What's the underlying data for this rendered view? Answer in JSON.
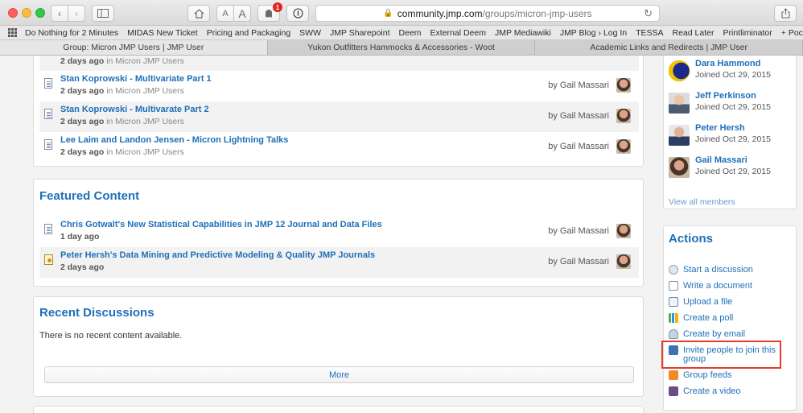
{
  "browser": {
    "address_domain": "community.jmp.com",
    "address_path": "/groups/micron-jmp-users",
    "notification_count": "1",
    "bookmarks": [
      "Do Nothing for 2 Minutes",
      "MIDAS New Ticket",
      "Pricing and Packaging",
      "SWW",
      "JMP Sharepoint",
      "Deem",
      "External Deem",
      "JMP Mediawiki",
      "JMP Blog › Log In",
      "TESSA",
      "Read Later",
      "Printliminator",
      "+ Pocket"
    ],
    "tabs": [
      "Group: Micron JMP Users | JMP User",
      "Yukon Outfitters Hammocks & Accessories - Woot",
      "Academic Links and Redirects | JMP User"
    ]
  },
  "content_list": {
    "rows": [
      {
        "title": "",
        "time": "2 days ago",
        "in_text": " in Micron JMP Users",
        "by": ""
      },
      {
        "title": "Stan Koprowski - Multivariate Part 1",
        "time": "2 days ago",
        "in_text": " in Micron JMP Users",
        "by": "by Gail Massari"
      },
      {
        "title": "Stan Koprowski - Multivarate Part 2",
        "time": "2 days ago",
        "in_text": " in Micron JMP Users",
        "by": "by Gail Massari"
      },
      {
        "title": "Lee Laim and Landon Jensen - Micron Lightning Talks",
        "time": "2 days ago",
        "in_text": " in Micron JMP Users",
        "by": "by Gail Massari"
      }
    ]
  },
  "featured": {
    "title": "Featured Content",
    "rows": [
      {
        "title": "Chris Gotwalt's New Statistical Capabilities in JMP 12 Journal and Data Files",
        "time": "1 day ago",
        "by": "by Gail Massari"
      },
      {
        "title": "Peter Hersh's Data Mining and Predictive Modeling & Quality JMP Journals",
        "time": "2 days ago",
        "by": "by Gail Massari"
      }
    ]
  },
  "discussions": {
    "title": "Recent Discussions",
    "empty_text": "There is no recent content available.",
    "more_label": "More"
  },
  "members": {
    "list": [
      {
        "name": "Dara Hammond",
        "joined": "Joined Oct 29, 2015"
      },
      {
        "name": "Jeff Perkinson",
        "joined": "Joined Oct 29, 2015"
      },
      {
        "name": "Peter Hersh",
        "joined": "Joined Oct 29, 2015"
      },
      {
        "name": "Gail Massari",
        "joined": "Joined Oct 29, 2015"
      }
    ],
    "view_all": "View all members"
  },
  "actions": {
    "title": "Actions",
    "items": [
      "Start a discussion",
      "Write a document",
      "Upload a file",
      "Create a poll",
      "Create by email",
      "Invite people to join this group",
      "Group feeds",
      "Create a video"
    ]
  },
  "colors": {
    "link": "#1f6fb8",
    "highlight": "#e33b2e"
  }
}
